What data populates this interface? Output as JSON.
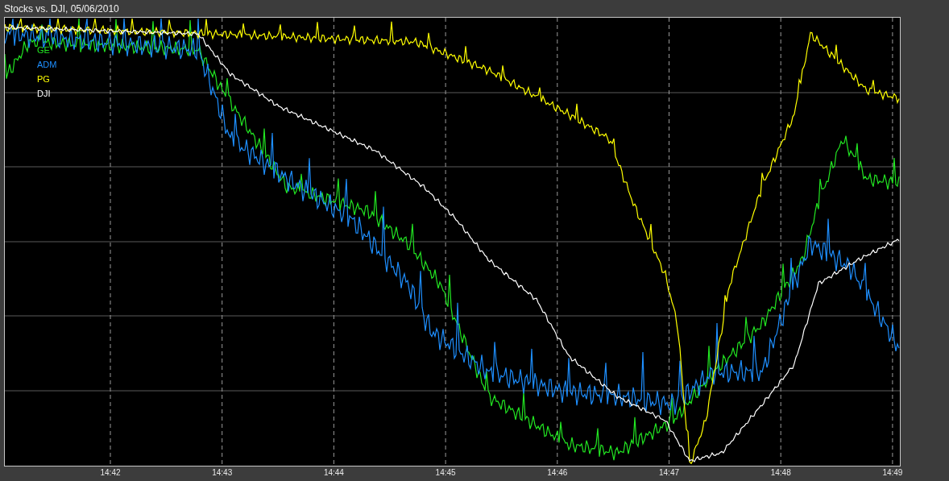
{
  "window": {
    "title": "Stocks vs. DJI, 05/06/2010"
  },
  "chart": {
    "legend": [
      {
        "label": "GE",
        "color": "#22e622"
      },
      {
        "label": "ADM",
        "color": "#1e8fff"
      },
      {
        "label": "PG",
        "color": "#ffff00"
      },
      {
        "label": "DJI",
        "color": "#ffffff"
      }
    ],
    "x_labels": [
      "14:42",
      "14:43",
      "14:44",
      "14:45",
      "14:46",
      "14:47",
      "14:48",
      "14:49"
    ]
  }
}
